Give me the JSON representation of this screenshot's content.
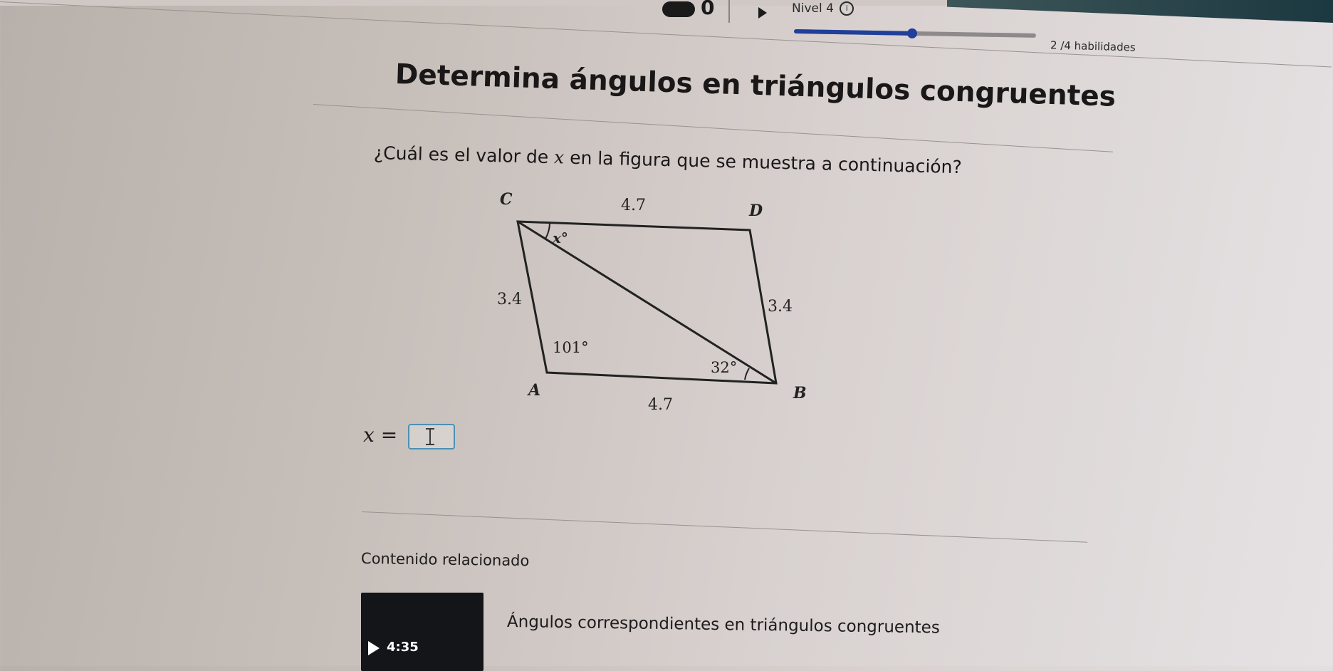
{
  "header": {
    "streak_count": "0",
    "level_label": "Nivel 4",
    "info_icon": "info-icon",
    "progress": {
      "value": 2,
      "total": 4
    },
    "skills_text": "2 /4 habilidades"
  },
  "exercise": {
    "title": "Determina ángulos en triángulos congruentes",
    "question_before": "¿Cuál es el valor de ",
    "question_var": "x",
    "question_after": " en la figura que se muestra a continuación?",
    "answer_label": "x =",
    "answer_value": ""
  },
  "figure": {
    "vertices": {
      "C": "C",
      "D": "D",
      "A": "A",
      "B": "B"
    },
    "side_labels": {
      "CD": "4.7",
      "AB": "4.7",
      "CA": "3.4",
      "DB": "3.4"
    },
    "angle_labels": {
      "C": "x°",
      "A": "101°",
      "B": "32°"
    }
  },
  "related": {
    "heading": "Contenido relacionado",
    "video": {
      "title": "Ángulos correspondientes en triángulos congruentes",
      "duration": "4:35"
    }
  }
}
